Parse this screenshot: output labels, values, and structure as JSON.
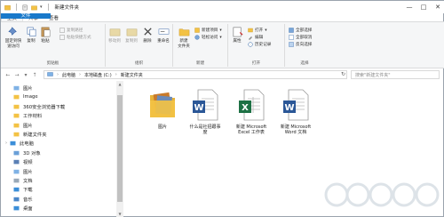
{
  "window": {
    "title": "新建文件夹",
    "controls": [
      "—",
      "□",
      "✕"
    ]
  },
  "tabs": [
    {
      "label": "文件",
      "kind": "file"
    },
    {
      "label": "主页",
      "kind": "active"
    },
    {
      "label": "共享",
      "kind": "normal"
    },
    {
      "label": "查看",
      "kind": "normal"
    }
  ],
  "ribbon": {
    "clipboard": {
      "pin_line1": "固定到快",
      "pin_line2": "速访问",
      "copy": "复制",
      "paste": "粘贴",
      "copy_path": "复制路径",
      "paste_shortcut": "粘贴快捷方式",
      "label": "剪贴板"
    },
    "organize": {
      "move_to": "移动到",
      "copy_to": "复制到",
      "delete": "删除",
      "rename": "重命名",
      "label": "组织"
    },
    "new": {
      "new_folder_line1": "新建",
      "new_folder_line2": "文件夹",
      "new_item": "新建项目",
      "easy_access": "轻松访问",
      "label": "新建"
    },
    "open": {
      "properties": "属性",
      "open": "打开",
      "edit": "编辑",
      "history": "历史记录",
      "label": "打开"
    },
    "select": {
      "select_all": "全部选择",
      "select_none": "全部取消",
      "invert": "反向选择",
      "label": "选择"
    }
  },
  "address": {
    "crumbs": [
      "此电脑",
      "本地磁盘 (C:)",
      "新建文件夹"
    ],
    "search_placeholder": "搜索\"新建文件夹\""
  },
  "sidebar": {
    "items": [
      {
        "label": "图片",
        "icon": "pictures-icon",
        "indent": 1
      },
      {
        "label": "Image",
        "icon": "folder-icon",
        "indent": 1
      },
      {
        "label": "360安全浏览器下载",
        "icon": "folder-icon",
        "indent": 1
      },
      {
        "label": "工作材料",
        "icon": "folder-icon",
        "indent": 1
      },
      {
        "label": "图片",
        "icon": "folder-icon",
        "indent": 1
      },
      {
        "label": "新建文件夹",
        "icon": "folder-icon",
        "indent": 1
      },
      {
        "label": "此电脑",
        "icon": "this-pc-icon",
        "indent": 0
      },
      {
        "label": "3D 对象",
        "icon": "3d-objects-icon",
        "indent": 1
      },
      {
        "label": "视频",
        "icon": "videos-icon",
        "indent": 1
      },
      {
        "label": "图片",
        "icon": "pictures-icon",
        "indent": 1
      },
      {
        "label": "文档",
        "icon": "documents-icon",
        "indent": 1
      },
      {
        "label": "下载",
        "icon": "downloads-icon",
        "indent": 1
      },
      {
        "label": "音乐",
        "icon": "music-icon",
        "indent": 1
      },
      {
        "label": "桌面",
        "icon": "desktop-icon",
        "indent": 1
      }
    ]
  },
  "files": [
    {
      "name": "图片",
      "type": "folder"
    },
    {
      "name": "什么是社招跟事\n度",
      "type": "word"
    },
    {
      "name": "新建 Microsoft\nExcel 工作表",
      "type": "excel"
    },
    {
      "name": "新建 Microsoft\nWord 文档",
      "type": "word"
    }
  ],
  "colors": {
    "accent": "#1979ca",
    "folder": "#f3c244",
    "word": "#2b5797",
    "excel": "#1e7145"
  }
}
